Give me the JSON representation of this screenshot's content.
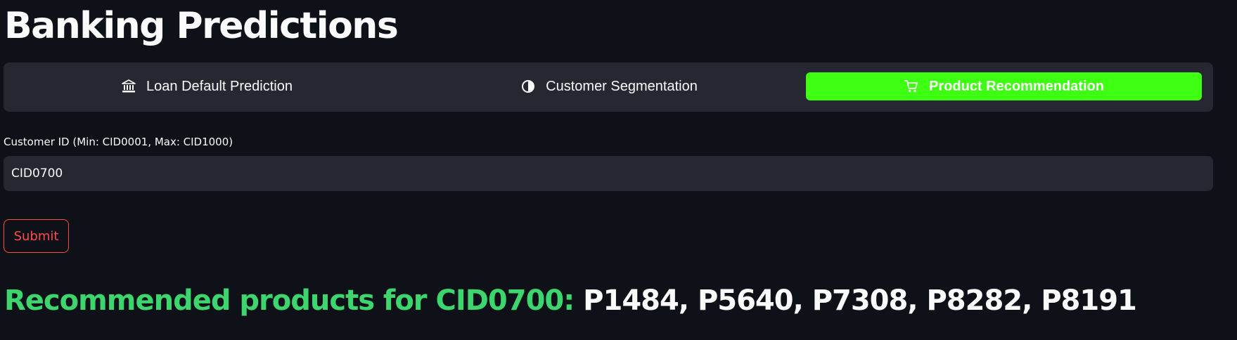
{
  "page": {
    "title": "Banking Predictions"
  },
  "tabs": [
    {
      "label": "Loan Default Prediction",
      "icon": "bank-icon",
      "active": false
    },
    {
      "label": "Customer Segmentation",
      "icon": "half-circle-icon",
      "active": false
    },
    {
      "label": "Product Recommendation",
      "icon": "cart-icon",
      "active": true
    }
  ],
  "form": {
    "customer_id_label": "Customer ID (Min: CID0001, Max: CID1000)",
    "customer_id_value": "CID0700",
    "submit_label": "Submit"
  },
  "result": {
    "lead": "Recommended products for CID0700:",
    "products": "P1484, P5640, P7308, P8282, P8191"
  },
  "colors": {
    "background": "#0e1117",
    "surface": "#262730",
    "active_tab": "#3eff12",
    "accent_red": "#ff4b4b",
    "result_green": "#3dd56d"
  }
}
